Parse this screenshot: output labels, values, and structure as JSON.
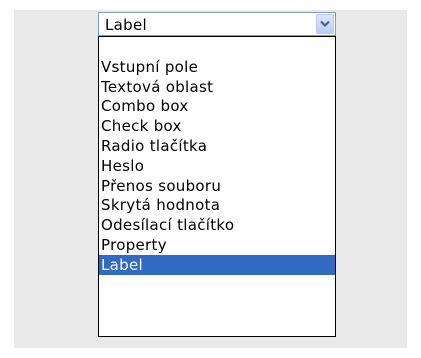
{
  "dropdown": {
    "selected_value": "Label",
    "options": [
      "",
      "Vstupní pole",
      "Textová oblast",
      "Combo box",
      "Check box",
      "Radio tlačítka",
      "Heslo",
      "Přenos souboru",
      "Skrytá hodnota",
      "Odesílací tlačítko",
      "Property",
      "Label"
    ],
    "selected_index": 11,
    "button_icon": "chevron-down-icon"
  },
  "colors": {
    "panel_background": "#e9e9e9",
    "selection_highlight": "#316ac5",
    "selection_text": "#ffffff",
    "list_border": "#000000"
  }
}
